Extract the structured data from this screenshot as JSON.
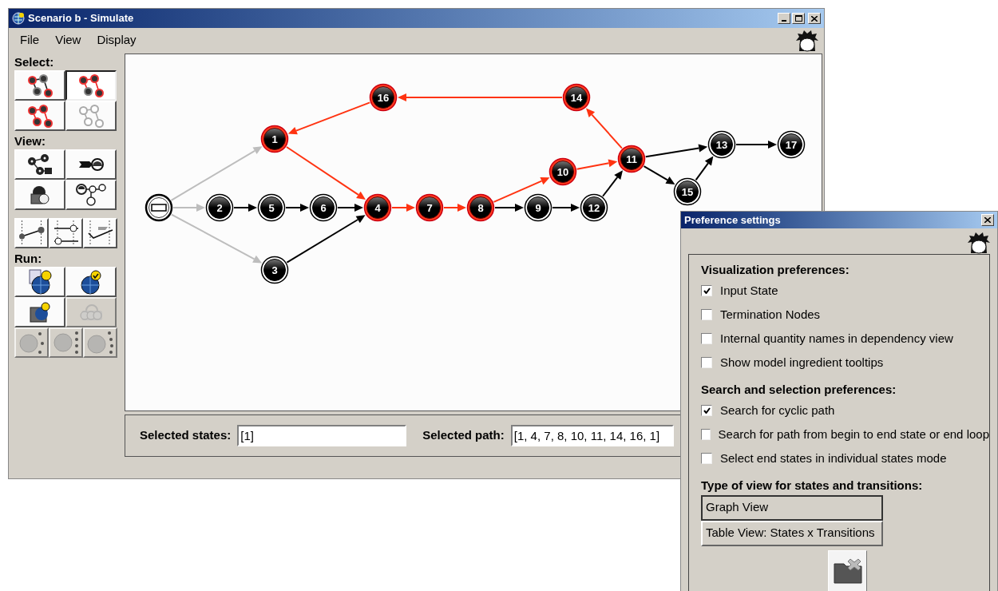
{
  "window": {
    "title": "Scenario b - Simulate"
  },
  "menu": [
    {
      "label": "File"
    },
    {
      "label": "View"
    },
    {
      "label": "Display"
    }
  ],
  "toolbar": [
    {
      "label": "Select:",
      "rows": [
        [
          {
            "selected": false,
            "disabled": false
          },
          {
            "selected": true,
            "disabled": false
          }
        ],
        [
          {
            "selected": false,
            "disabled": false
          },
          {
            "selected": false,
            "disabled": false
          }
        ]
      ]
    },
    {
      "label": "View:",
      "rows": [
        [
          {
            "selected": false,
            "disabled": false
          },
          {
            "selected": false,
            "disabled": false
          }
        ],
        [
          {
            "selected": false,
            "disabled": false
          },
          {
            "selected": false,
            "disabled": false
          }
        ]
      ]
    },
    {
      "rows": [
        [
          {
            "selected": false,
            "disabled": false
          },
          {
            "selected": false,
            "disabled": false
          },
          {
            "selected": false,
            "disabled": false
          }
        ]
      ]
    },
    {
      "label": "Run:",
      "rows": [
        [
          {
            "selected": false,
            "disabled": false
          },
          {
            "selected": false,
            "disabled": false
          }
        ],
        [
          {
            "selected": false,
            "disabled": false
          },
          {
            "selected": false,
            "disabled": true
          }
        ],
        [
          {
            "selected": false,
            "disabled": true
          },
          {
            "selected": false,
            "disabled": true
          },
          {
            "selected": false,
            "disabled": true
          }
        ]
      ]
    }
  ],
  "graph": {
    "nodes": [
      {
        "kind": "start",
        "selected": false
      },
      {
        "kind": "state",
        "label": "2",
        "selected": false
      },
      {
        "kind": "state",
        "label": "5",
        "selected": false
      },
      {
        "kind": "state",
        "label": "1",
        "selected": true
      },
      {
        "kind": "state",
        "label": "3",
        "selected": false
      },
      {
        "kind": "state",
        "label": "6",
        "selected": false
      },
      {
        "kind": "state",
        "label": "4",
        "selected": true
      },
      {
        "kind": "state",
        "label": "16",
        "selected": true
      },
      {
        "kind": "state",
        "label": "7",
        "selected": true
      },
      {
        "kind": "state",
        "label": "8",
        "selected": true
      },
      {
        "kind": "state",
        "label": "9",
        "selected": false
      },
      {
        "kind": "state",
        "label": "10",
        "selected": true
      },
      {
        "kind": "state",
        "label": "14",
        "selected": true
      },
      {
        "kind": "state",
        "label": "12",
        "selected": false
      },
      {
        "kind": "state",
        "label": "11",
        "selected": true
      },
      {
        "kind": "state",
        "label": "15",
        "selected": false
      },
      {
        "kind": "state",
        "label": "13",
        "selected": false
      },
      {
        "kind": "state",
        "label": "17",
        "selected": false
      }
    ],
    "edges": [
      {
        "kind": "dimmed"
      },
      {
        "kind": "dimmed"
      },
      {
        "kind": "dimmed"
      },
      {
        "kind": "normal"
      },
      {
        "kind": "normal"
      },
      {
        "kind": "normal"
      },
      {
        "kind": "normal"
      },
      {
        "kind": "highlighted"
      },
      {
        "kind": "highlighted"
      },
      {
        "kind": "highlighted"
      },
      {
        "kind": "highlighted"
      },
      {
        "kind": "highlighted"
      },
      {
        "kind": "highlighted"
      },
      {
        "kind": "highlighted"
      },
      {
        "kind": "highlighted"
      },
      {
        "kind": "normal"
      },
      {
        "kind": "normal"
      },
      {
        "kind": "normal"
      },
      {
        "kind": "normal"
      },
      {
        "kind": "normal"
      },
      {
        "kind": "normal"
      },
      {
        "kind": "normal"
      }
    ]
  },
  "selection": {
    "states_label": "Selected states:",
    "states_value": "[1]",
    "path_label": "Selected path:",
    "path_value": "[1, 4, 7, 8, 10, 11, 14, 16, 1]"
  },
  "dialog": {
    "title": "Preference settings",
    "sections": [
      {
        "heading": "Visualization preferences:",
        "options": [
          {
            "label": "Input State",
            "checked": true
          },
          {
            "label": "Termination Nodes",
            "checked": false
          },
          {
            "label": "Internal quantity names in dependency view",
            "checked": false
          },
          {
            "label": "Show model ingredient tooltips",
            "checked": false
          }
        ]
      },
      {
        "heading": "Search and selection preferences:",
        "options": [
          {
            "label": "Search for cyclic path",
            "checked": true
          },
          {
            "label": "Search for path from begin to end state or end loop",
            "checked": false
          },
          {
            "label": "Select end states in individual states mode",
            "checked": false
          }
        ]
      }
    ],
    "view_heading": "Type of view for states and transitions:",
    "view_types": [
      {
        "label": "Graph View",
        "selected": true
      },
      {
        "label": "Table View: States x Transitions",
        "selected": false
      }
    ]
  }
}
